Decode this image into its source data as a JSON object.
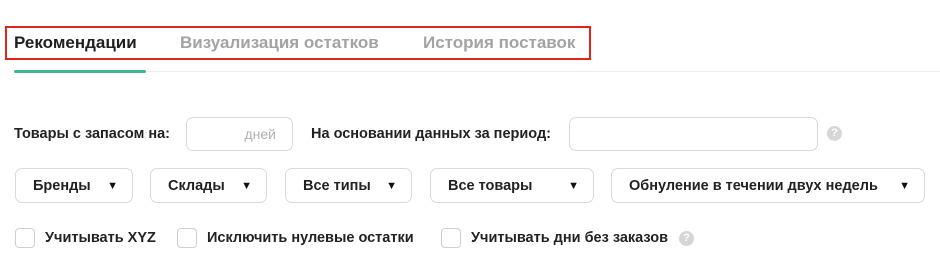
{
  "tabs": [
    {
      "label": "Рекомендации",
      "active": true
    },
    {
      "label": "Визуализация остатков",
      "active": false
    },
    {
      "label": "История поставок",
      "active": false
    }
  ],
  "stock_form": {
    "stock_label": "Товары с запасом на:",
    "days_value": "",
    "days_placeholder": "дней",
    "period_label": "На основании данных за период:",
    "period_value": ""
  },
  "filters": {
    "brands": "Бренды",
    "warehouses": "Склады",
    "types": "Все типы",
    "products": "Все товары",
    "reset": "Обнуление в течении двух недель"
  },
  "checkboxes": {
    "xyz": {
      "label": "Учитывать XYZ",
      "checked": false
    },
    "exclude_zero": {
      "label": "Исключить нулевые остатки",
      "checked": false
    },
    "no_order_days": {
      "label": "Учитывать дни без заказов",
      "checked": false
    }
  },
  "help_glyph": "?",
  "colors": {
    "accent": "#45b58b",
    "highlight_border": "#e3241b"
  }
}
